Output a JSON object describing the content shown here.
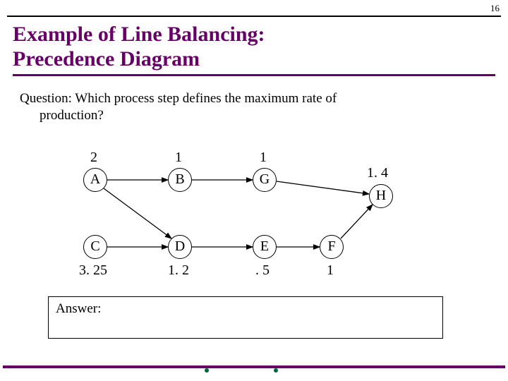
{
  "page_number": "16",
  "title_line1": "Example of Line Balancing:",
  "title_line2": "Precedence Diagram",
  "question_line1": "Question: Which process step defines the maximum rate of",
  "question_line2": "production?",
  "answer_label": "Answer:",
  "nodes": {
    "A": {
      "label": "A",
      "time": "2"
    },
    "B": {
      "label": "B",
      "time": "1"
    },
    "G": {
      "label": "G",
      "time": "1"
    },
    "H": {
      "label": "H",
      "time": "1. 4"
    },
    "C": {
      "label": "C",
      "time": "3. 25"
    },
    "D": {
      "label": "D",
      "time": "1. 2"
    },
    "E": {
      "label": "E",
      "time": ". 5"
    },
    "F": {
      "label": "F",
      "time": "1"
    }
  },
  "edges": [
    [
      "A",
      "B"
    ],
    [
      "B",
      "G"
    ],
    [
      "G",
      "H"
    ],
    [
      "A",
      "D"
    ],
    [
      "C",
      "D"
    ],
    [
      "D",
      "E"
    ],
    [
      "E",
      "F"
    ],
    [
      "F",
      "H"
    ]
  ],
  "chart_data": {
    "type": "table",
    "description": "Precedence diagram task times",
    "tasks": [
      {
        "task": "A",
        "time": 2,
        "predecessors": []
      },
      {
        "task": "B",
        "time": 1,
        "predecessors": [
          "A"
        ]
      },
      {
        "task": "G",
        "time": 1,
        "predecessors": [
          "B"
        ]
      },
      {
        "task": "C",
        "time": 3.25,
        "predecessors": []
      },
      {
        "task": "D",
        "time": 1.2,
        "predecessors": [
          "A",
          "C"
        ]
      },
      {
        "task": "E",
        "time": 0.5,
        "predecessors": [
          "D"
        ]
      },
      {
        "task": "F",
        "time": 1,
        "predecessors": [
          "E"
        ]
      },
      {
        "task": "H",
        "time": 1.4,
        "predecessors": [
          "G",
          "F"
        ]
      }
    ]
  }
}
